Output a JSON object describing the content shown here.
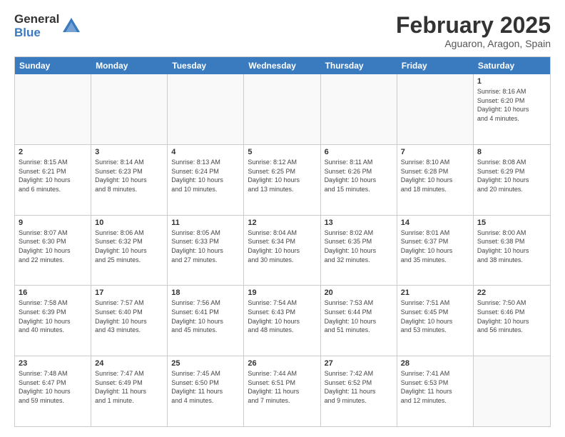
{
  "logo": {
    "general": "General",
    "blue": "Blue"
  },
  "title": "February 2025",
  "location": "Aguaron, Aragon, Spain",
  "header_days": [
    "Sunday",
    "Monday",
    "Tuesday",
    "Wednesday",
    "Thursday",
    "Friday",
    "Saturday"
  ],
  "weeks": [
    [
      {
        "day": "",
        "info": ""
      },
      {
        "day": "",
        "info": ""
      },
      {
        "day": "",
        "info": ""
      },
      {
        "day": "",
        "info": ""
      },
      {
        "day": "",
        "info": ""
      },
      {
        "day": "",
        "info": ""
      },
      {
        "day": "1",
        "info": "Sunrise: 8:16 AM\nSunset: 6:20 PM\nDaylight: 10 hours\nand 4 minutes."
      }
    ],
    [
      {
        "day": "2",
        "info": "Sunrise: 8:15 AM\nSunset: 6:21 PM\nDaylight: 10 hours\nand 6 minutes."
      },
      {
        "day": "3",
        "info": "Sunrise: 8:14 AM\nSunset: 6:23 PM\nDaylight: 10 hours\nand 8 minutes."
      },
      {
        "day": "4",
        "info": "Sunrise: 8:13 AM\nSunset: 6:24 PM\nDaylight: 10 hours\nand 10 minutes."
      },
      {
        "day": "5",
        "info": "Sunrise: 8:12 AM\nSunset: 6:25 PM\nDaylight: 10 hours\nand 13 minutes."
      },
      {
        "day": "6",
        "info": "Sunrise: 8:11 AM\nSunset: 6:26 PM\nDaylight: 10 hours\nand 15 minutes."
      },
      {
        "day": "7",
        "info": "Sunrise: 8:10 AM\nSunset: 6:28 PM\nDaylight: 10 hours\nand 18 minutes."
      },
      {
        "day": "8",
        "info": "Sunrise: 8:08 AM\nSunset: 6:29 PM\nDaylight: 10 hours\nand 20 minutes."
      }
    ],
    [
      {
        "day": "9",
        "info": "Sunrise: 8:07 AM\nSunset: 6:30 PM\nDaylight: 10 hours\nand 22 minutes."
      },
      {
        "day": "10",
        "info": "Sunrise: 8:06 AM\nSunset: 6:32 PM\nDaylight: 10 hours\nand 25 minutes."
      },
      {
        "day": "11",
        "info": "Sunrise: 8:05 AM\nSunset: 6:33 PM\nDaylight: 10 hours\nand 27 minutes."
      },
      {
        "day": "12",
        "info": "Sunrise: 8:04 AM\nSunset: 6:34 PM\nDaylight: 10 hours\nand 30 minutes."
      },
      {
        "day": "13",
        "info": "Sunrise: 8:02 AM\nSunset: 6:35 PM\nDaylight: 10 hours\nand 32 minutes."
      },
      {
        "day": "14",
        "info": "Sunrise: 8:01 AM\nSunset: 6:37 PM\nDaylight: 10 hours\nand 35 minutes."
      },
      {
        "day": "15",
        "info": "Sunrise: 8:00 AM\nSunset: 6:38 PM\nDaylight: 10 hours\nand 38 minutes."
      }
    ],
    [
      {
        "day": "16",
        "info": "Sunrise: 7:58 AM\nSunset: 6:39 PM\nDaylight: 10 hours\nand 40 minutes."
      },
      {
        "day": "17",
        "info": "Sunrise: 7:57 AM\nSunset: 6:40 PM\nDaylight: 10 hours\nand 43 minutes."
      },
      {
        "day": "18",
        "info": "Sunrise: 7:56 AM\nSunset: 6:41 PM\nDaylight: 10 hours\nand 45 minutes."
      },
      {
        "day": "19",
        "info": "Sunrise: 7:54 AM\nSunset: 6:43 PM\nDaylight: 10 hours\nand 48 minutes."
      },
      {
        "day": "20",
        "info": "Sunrise: 7:53 AM\nSunset: 6:44 PM\nDaylight: 10 hours\nand 51 minutes."
      },
      {
        "day": "21",
        "info": "Sunrise: 7:51 AM\nSunset: 6:45 PM\nDaylight: 10 hours\nand 53 minutes."
      },
      {
        "day": "22",
        "info": "Sunrise: 7:50 AM\nSunset: 6:46 PM\nDaylight: 10 hours\nand 56 minutes."
      }
    ],
    [
      {
        "day": "23",
        "info": "Sunrise: 7:48 AM\nSunset: 6:47 PM\nDaylight: 10 hours\nand 59 minutes."
      },
      {
        "day": "24",
        "info": "Sunrise: 7:47 AM\nSunset: 6:49 PM\nDaylight: 11 hours\nand 1 minute."
      },
      {
        "day": "25",
        "info": "Sunrise: 7:45 AM\nSunset: 6:50 PM\nDaylight: 11 hours\nand 4 minutes."
      },
      {
        "day": "26",
        "info": "Sunrise: 7:44 AM\nSunset: 6:51 PM\nDaylight: 11 hours\nand 7 minutes."
      },
      {
        "day": "27",
        "info": "Sunrise: 7:42 AM\nSunset: 6:52 PM\nDaylight: 11 hours\nand 9 minutes."
      },
      {
        "day": "28",
        "info": "Sunrise: 7:41 AM\nSunset: 6:53 PM\nDaylight: 11 hours\nand 12 minutes."
      },
      {
        "day": "",
        "info": ""
      }
    ]
  ]
}
